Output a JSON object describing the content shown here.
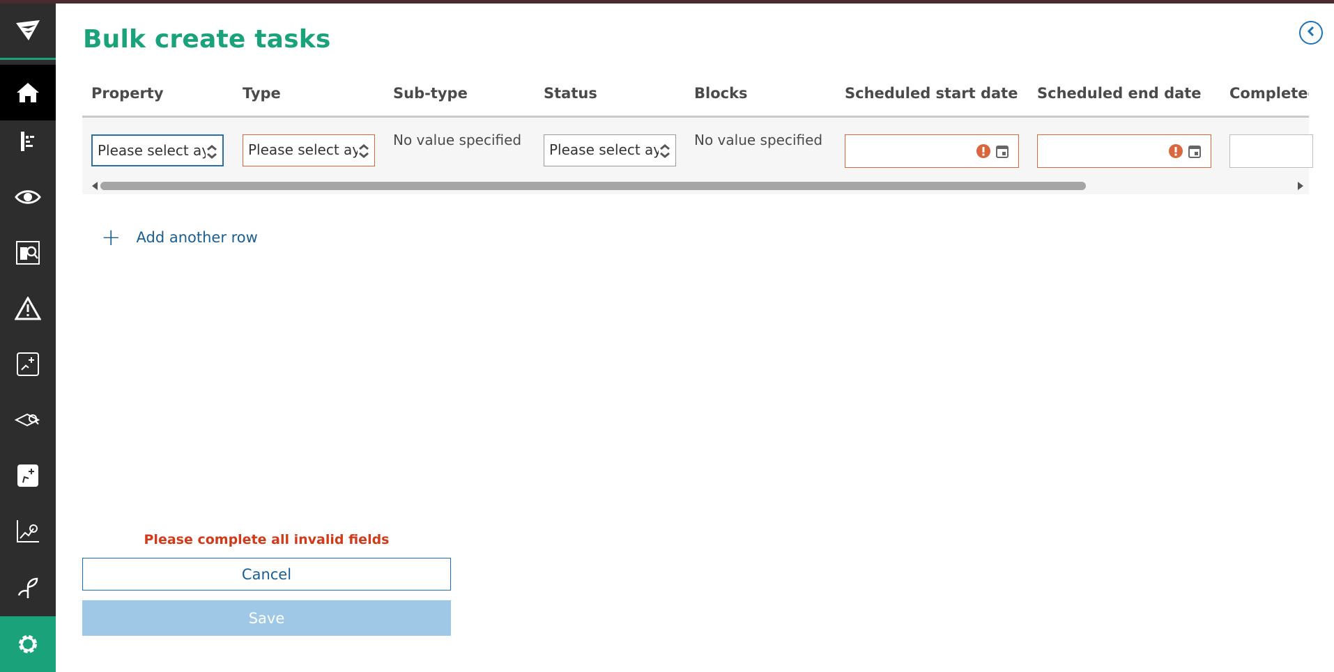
{
  "page": {
    "title": "Bulk create tasks"
  },
  "columns": [
    "Property",
    "Type",
    "Sub-type",
    "Status",
    "Blocks",
    "Scheduled start date",
    "Scheduled end date",
    "Completed"
  ],
  "row": {
    "property_placeholder": "Please select ayc",
    "type_placeholder": "Please select ayc",
    "subtype_value": "No value specified",
    "status_placeholder": "Please select ayc",
    "blocks_value": "No value specified"
  },
  "actions": {
    "add_row": "Add another row",
    "validation_message": "Please complete all invalid fields",
    "cancel": "Cancel",
    "save": "Save"
  },
  "sidebar": {
    "items": [
      "logo-icon",
      "home-icon",
      "properties-icon",
      "eye-icon",
      "search-map-icon",
      "warning-icon",
      "analytics-icon",
      "map-search-icon",
      "growth-icon",
      "chart-search-icon",
      "plant-icon",
      "settings-icon"
    ]
  },
  "colors": {
    "accent": "#1aa37a",
    "link": "#1a5f94",
    "invalid": "#d9663d",
    "error_text": "#d23a1a",
    "sidebar": "#2d2d2d"
  }
}
